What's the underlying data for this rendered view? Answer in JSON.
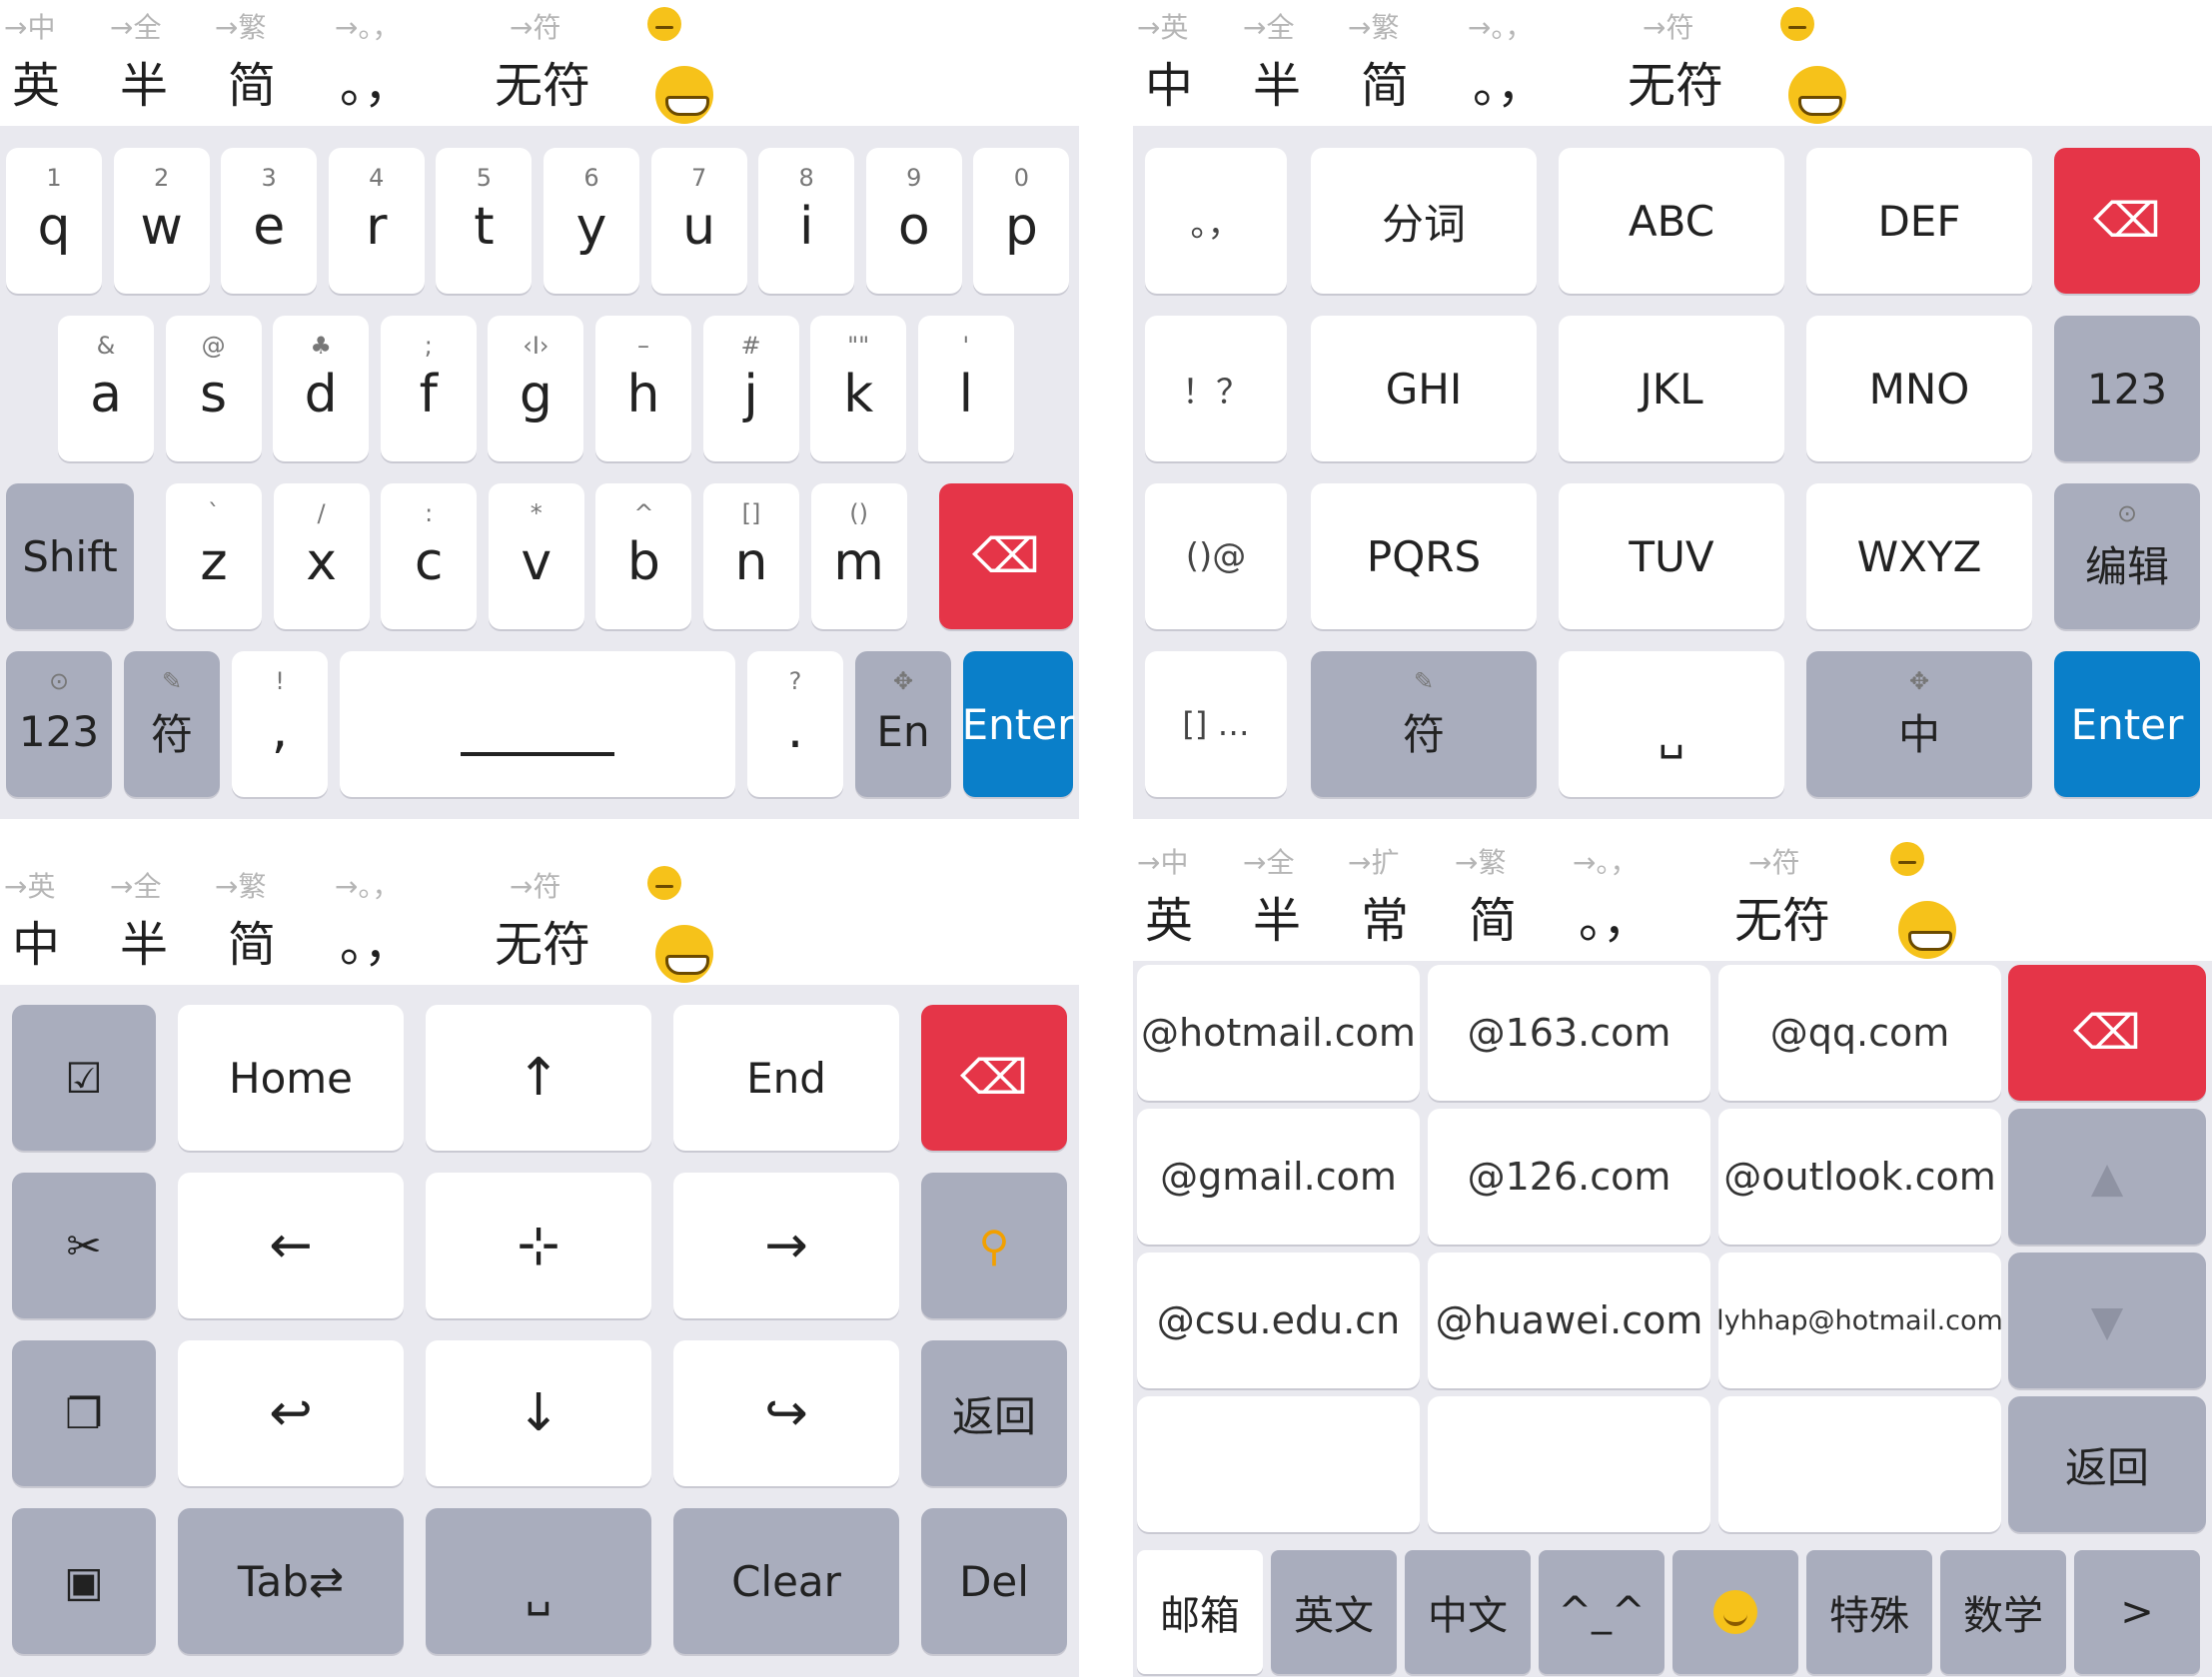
{
  "qwerty": {
    "hints": [
      "→中",
      "→全",
      "→繁",
      "→。，",
      "→符"
    ],
    "options": [
      "英",
      "半",
      "简",
      "。，",
      "无符"
    ],
    "row1": [
      {
        "sup": "1",
        "key": "q"
      },
      {
        "sup": "2",
        "key": "w"
      },
      {
        "sup": "3",
        "key": "e"
      },
      {
        "sup": "4",
        "key": "r"
      },
      {
        "sup": "5",
        "key": "t"
      },
      {
        "sup": "6",
        "key": "y"
      },
      {
        "sup": "7",
        "key": "u"
      },
      {
        "sup": "8",
        "key": "i"
      },
      {
        "sup": "9",
        "key": "o"
      },
      {
        "sup": "0",
        "key": "p"
      }
    ],
    "row2": [
      {
        "sup": "&",
        "key": "a"
      },
      {
        "sup": "@",
        "key": "s"
      },
      {
        "sup": "♣",
        "key": "d"
      },
      {
        "sup": ";",
        "key": "f"
      },
      {
        "sup": "‹I›",
        "key": "g"
      },
      {
        "sup": "–",
        "key": "h"
      },
      {
        "sup": "#",
        "key": "j"
      },
      {
        "sup": "\"\"",
        "key": "k"
      },
      {
        "sup": "'",
        "key": "l"
      }
    ],
    "row3": [
      {
        "sup": "`",
        "key": "z"
      },
      {
        "sup": "/",
        "key": "x"
      },
      {
        "sup": ":",
        "key": "c"
      },
      {
        "sup": "*",
        "key": "v"
      },
      {
        "sup": "^",
        "key": "b"
      },
      {
        "sup": "[]",
        "key": "n"
      },
      {
        "sup": "()",
        "key": "m"
      }
    ],
    "shift": "Shift",
    "num": "123",
    "sym": "符",
    "comma_sup": "!",
    "comma": ",",
    "period_sup": "?",
    "period": ".",
    "en": "En",
    "enter": "Enter",
    "backspace": "⌫"
  },
  "t9": {
    "hints": [
      "→英",
      "→全",
      "→繁",
      "→。，",
      "→符"
    ],
    "options": [
      "中",
      "半",
      "简",
      "。，",
      "无符"
    ],
    "rows": [
      [
        "。，",
        "分词",
        "ABC",
        "DEF"
      ],
      [
        "！？",
        "GHI",
        "JKL",
        "MNO"
      ],
      [
        "()@",
        "PQRS",
        "TUV",
        "WXYZ"
      ]
    ],
    "side": [
      "123",
      "编辑"
    ],
    "bottom_left": "[] …",
    "sym": "符",
    "space": "␣",
    "lang": "中",
    "enter": "Enter",
    "backspace": "⌫"
  },
  "nav": {
    "hints": [
      "→英",
      "→全",
      "→繁",
      "→。，",
      "→符"
    ],
    "options": [
      "中",
      "半",
      "简",
      "。，",
      "无符"
    ],
    "home": "Home",
    "up": "↑",
    "end": "End",
    "left": "←",
    "move": "⊹",
    "right": "→",
    "undo": "↩",
    "down": "↓",
    "redo": "↪",
    "back": "返回",
    "tab": "Tab⇄",
    "space": "␣",
    "clear": "Clear",
    "del": "Del",
    "select": "☑",
    "cut": "✂",
    "copy": "❐",
    "paste": "▣",
    "backspace": "⌫"
  },
  "email": {
    "hints": [
      "→中",
      "→全",
      "→扩",
      "→繁",
      "→。，",
      "→符"
    ],
    "options": [
      "英",
      "半",
      "常",
      "简",
      "。，",
      "无符"
    ],
    "grid": [
      [
        "@hotmail.com",
        "@163.com",
        "@qq.com"
      ],
      [
        "@gmail.com",
        "@126.com",
        "@outlook.com"
      ],
      [
        "@csu.edu.cn",
        "@huawei.com",
        "lyhhap@hotmail.com"
      ],
      [
        "",
        "",
        ""
      ]
    ],
    "back": "返回",
    "up": "▲",
    "down": "▼",
    "tabs": [
      "邮箱",
      "英文",
      "中文",
      "^_^",
      "",
      "特殊",
      "数学",
      ">"
    ],
    "backspace": "⌫"
  }
}
